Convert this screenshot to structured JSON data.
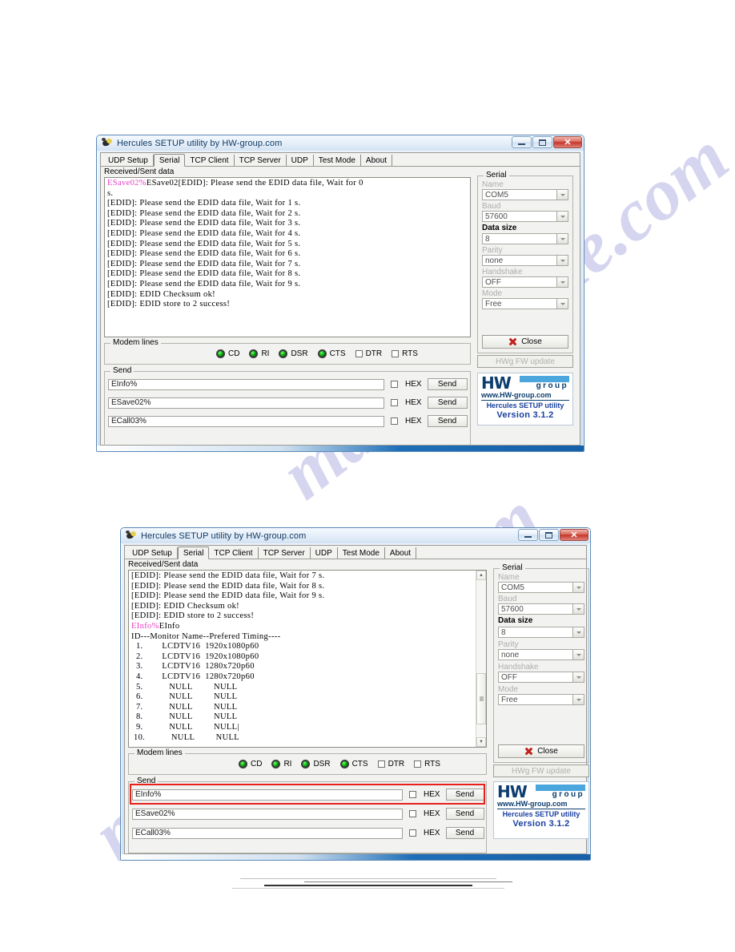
{
  "watermark": {
    "text_1": "manualshine.com",
    "text_2": "manualshine.com"
  },
  "windows": [
    {
      "id": "window-top",
      "title": "Hercules SETUP utility by HW-group.com",
      "window_buttons": {
        "minimize": "minimize",
        "maximize": "maximize",
        "close": "close"
      },
      "tabs": [
        {
          "label": "UDP Setup",
          "active": false
        },
        {
          "label": "Serial",
          "active": true
        },
        {
          "label": "TCP Client",
          "active": false
        },
        {
          "label": "TCP Server",
          "active": false
        },
        {
          "label": "UDP",
          "active": false
        },
        {
          "label": "Test Mode",
          "active": false
        },
        {
          "label": "About",
          "active": false
        }
      ],
      "console": {
        "label": "Received/Sent data",
        "lines": [
          {
            "magenta": "ESave02%",
            "text": "ESave02[EDID]: Please send the EDID data file, Wait for 0"
          },
          {
            "magenta": "",
            "text": "s."
          },
          {
            "magenta": "",
            "text": "[EDID]: Please send the EDID data file, Wait for 1 s."
          },
          {
            "magenta": "",
            "text": "[EDID]: Please send the EDID data file, Wait for 2 s."
          },
          {
            "magenta": "",
            "text": "[EDID]: Please send the EDID data file, Wait for 3 s."
          },
          {
            "magenta": "",
            "text": "[EDID]: Please send the EDID data file, Wait for 4 s."
          },
          {
            "magenta": "",
            "text": "[EDID]: Please send the EDID data file, Wait for 5 s."
          },
          {
            "magenta": "",
            "text": "[EDID]: Please send the EDID data file, Wait for 6 s."
          },
          {
            "magenta": "",
            "text": "[EDID]: Please send the EDID data file, Wait for 7 s."
          },
          {
            "magenta": "",
            "text": "[EDID]: Please send the EDID data file, Wait for 8 s."
          },
          {
            "magenta": "",
            "text": "[EDID]: Please send the EDID data file, Wait for 9 s."
          },
          {
            "magenta": "",
            "text": "[EDID]: EDID Checksum ok!"
          },
          {
            "magenta": "",
            "text": "[EDID]: EDID store to 2 success!"
          }
        ]
      },
      "serial": {
        "legend": "Serial",
        "fields": [
          {
            "label": "Name",
            "value": "COM5",
            "label_strong": false
          },
          {
            "label": "Baud",
            "value": "57600",
            "label_strong": false
          },
          {
            "label": "Data size",
            "value": "8",
            "label_strong": true
          },
          {
            "label": "Parity",
            "value": "none",
            "label_strong": false
          },
          {
            "label": "Handshake",
            "value": "OFF",
            "label_strong": false
          },
          {
            "label": "Mode",
            "value": "Free",
            "label_strong": false
          }
        ],
        "close_button": "Close",
        "fw_button": "HWg FW update"
      },
      "modem": {
        "legend": "Modem lines",
        "leds": [
          "CD",
          "RI",
          "DSR",
          "CTS"
        ],
        "checks": [
          "DTR",
          "RTS"
        ]
      },
      "send": {
        "legend": "Send",
        "rows": [
          {
            "value": "EInfo%",
            "hex_label": "HEX",
            "hex_checked": false,
            "button": "Send"
          },
          {
            "value": "ESave02%",
            "hex_label": "HEX",
            "hex_checked": false,
            "button": "Send"
          },
          {
            "value": "ECall03%",
            "hex_label": "HEX",
            "hex_checked": false,
            "button": "Send"
          }
        ]
      },
      "logo": {
        "brand_hw": "HW",
        "brand_group": "group",
        "url": "www.HW-group.com",
        "line2": "Hercules SETUP utility",
        "line3": "Version  3.1.2"
      }
    },
    {
      "id": "window-bottom",
      "title": "Hercules SETUP utility by HW-group.com",
      "window_buttons": {
        "minimize": "minimize",
        "maximize": "maximize",
        "close": "close"
      },
      "tabs": [
        {
          "label": "UDP Setup",
          "active": false
        },
        {
          "label": "Serial",
          "active": true
        },
        {
          "label": "TCP Client",
          "active": false
        },
        {
          "label": "TCP Server",
          "active": false
        },
        {
          "label": "UDP",
          "active": false
        },
        {
          "label": "Test Mode",
          "active": false
        },
        {
          "label": "About",
          "active": false
        }
      ],
      "console": {
        "label": "Received/Sent data",
        "lines": [
          {
            "magenta": "",
            "text": "[EDID]: Please send the EDID data file, Wait for 7 s."
          },
          {
            "magenta": "",
            "text": "[EDID]: Please send the EDID data file, Wait for 8 s."
          },
          {
            "magenta": "",
            "text": "[EDID]: Please send the EDID data file, Wait for 9 s."
          },
          {
            "magenta": "",
            "text": "[EDID]: EDID Checksum ok!"
          },
          {
            "magenta": "",
            "text": "[EDID]: EDID store to 2 success!"
          },
          {
            "magenta": "EInfo%",
            "text": "EInfo"
          },
          {
            "magenta": "",
            "text": "ID---Monitor Name--Prefered Timing----"
          },
          {
            "magenta": "",
            "text": "  1.        LCDTV16  1920x1080p60"
          },
          {
            "magenta": "",
            "text": "  2.        LCDTV16  1920x1080p60"
          },
          {
            "magenta": "",
            "text": "  3.        LCDTV16  1280x720p60"
          },
          {
            "magenta": "",
            "text": "  4.        LCDTV16  1280x720p60"
          },
          {
            "magenta": "",
            "text": "  5.           NULL         NULL"
          },
          {
            "magenta": "",
            "text": "  6.           NULL         NULL"
          },
          {
            "magenta": "",
            "text": "  7.           NULL         NULL"
          },
          {
            "magenta": "",
            "text": "  8.           NULL         NULL"
          },
          {
            "magenta": "",
            "text": "  9.           NULL         NULL|"
          },
          {
            "magenta": "",
            "text": " 10.           NULL         NULL"
          },
          {
            "magenta": "",
            "text": ""
          },
          {
            "magenta": "",
            "text": "----------------------------------------"
          }
        ]
      },
      "serial": {
        "legend": "Serial",
        "fields": [
          {
            "label": "Name",
            "value": "COM5",
            "label_strong": false
          },
          {
            "label": "Baud",
            "value": "57600",
            "label_strong": false
          },
          {
            "label": "Data size",
            "value": "8",
            "label_strong": true
          },
          {
            "label": "Parity",
            "value": "none",
            "label_strong": false
          },
          {
            "label": "Handshake",
            "value": "OFF",
            "label_strong": false
          },
          {
            "label": "Mode",
            "value": "Free",
            "label_strong": false
          }
        ],
        "close_button": "Close",
        "fw_button": "HWg FW update"
      },
      "modem": {
        "legend": "Modem lines",
        "leds": [
          "CD",
          "RI",
          "DSR",
          "CTS"
        ],
        "checks": [
          "DTR",
          "RTS"
        ]
      },
      "send": {
        "legend": "Send",
        "rows": [
          {
            "value": "EInfo%",
            "hex_label": "HEX",
            "hex_checked": false,
            "button": "Send"
          },
          {
            "value": "ESave02%",
            "hex_label": "HEX",
            "hex_checked": false,
            "button": "Send"
          },
          {
            "value": "ECall03%",
            "hex_label": "HEX",
            "hex_checked": false,
            "button": "Send"
          }
        ]
      },
      "logo": {
        "brand_hw": "HW",
        "brand_group": "group",
        "url": "www.HW-group.com",
        "line2": "Hercules SETUP utility",
        "line3": "Version  3.1.2"
      },
      "highlight_color": "#e8201b"
    }
  ]
}
